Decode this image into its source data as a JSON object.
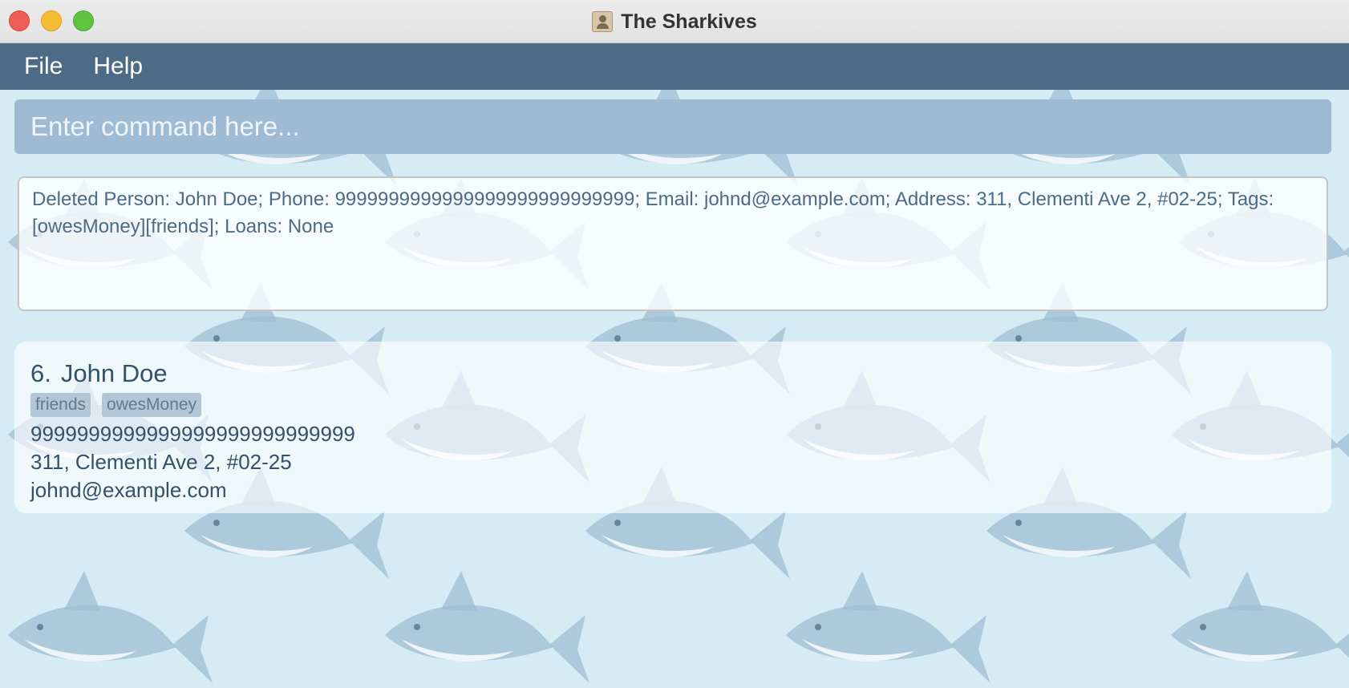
{
  "window": {
    "title": "The Sharkives",
    "app_icon": "contacts-book-icon"
  },
  "menubar": {
    "items": [
      {
        "label": "File"
      },
      {
        "label": "Help"
      }
    ]
  },
  "command": {
    "placeholder": "Enter command here...",
    "value": ""
  },
  "result": {
    "text": "Deleted Person: John Doe; Phone: 9999999999999999999999999999; Email: johnd@example.com; Address: 311, Clementi Ave 2, #02-25; Tags: [owesMoney][friends]; Loans: None"
  },
  "person_list": [
    {
      "index": "6.",
      "name": "John Doe",
      "tags": [
        "friends",
        "owesMoney"
      ],
      "phone": "9999999999999999999999999999",
      "address": "311, Clementi Ave 2, #02-25",
      "email": "johnd@example.com"
    }
  ],
  "colors": {
    "menubar": "#4e6b85",
    "command_box": "#9fbbd3",
    "background": "#d6ecf5",
    "text": "#34506a"
  }
}
